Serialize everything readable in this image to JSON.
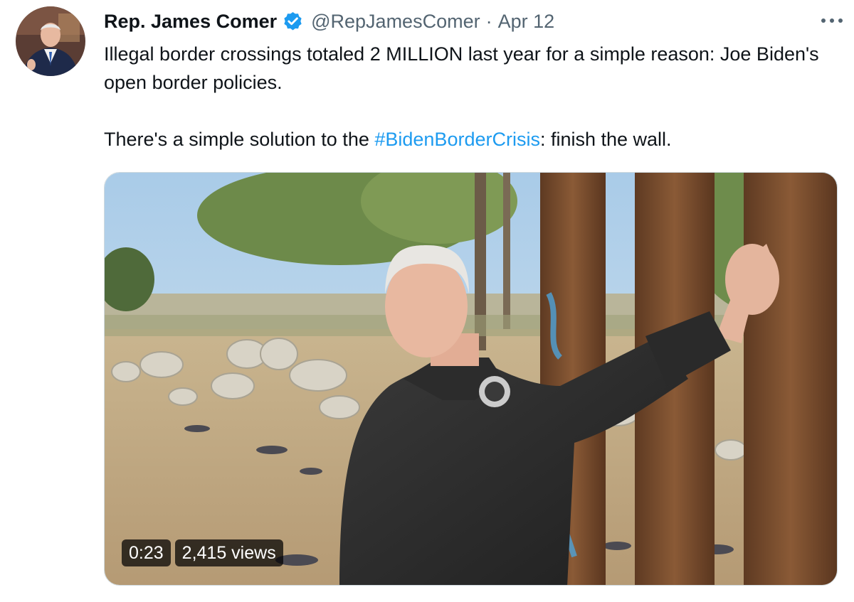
{
  "author": {
    "name": "Rep. James Comer",
    "handle": "@RepJamesComer",
    "separator": "·",
    "date": "Apr 12",
    "verified_color": "#1d9bf0"
  },
  "tweet": {
    "line1": "Illegal border crossings totaled 2 MILLION last year for a simple reason: Joe Biden's open border policies.",
    "line2_before": "There's a simple solution to the ",
    "hashtag": "#BidenBorderCrisis",
    "line2_after": ": finish the wall."
  },
  "video": {
    "duration": "0:23",
    "views": "2,415 views"
  },
  "icons": {
    "more": "more-horizontal-icon",
    "verified": "verified-badge-icon"
  },
  "colors": {
    "text": "#0f1419",
    "secondary": "#536471",
    "link": "#1d9bf0"
  }
}
